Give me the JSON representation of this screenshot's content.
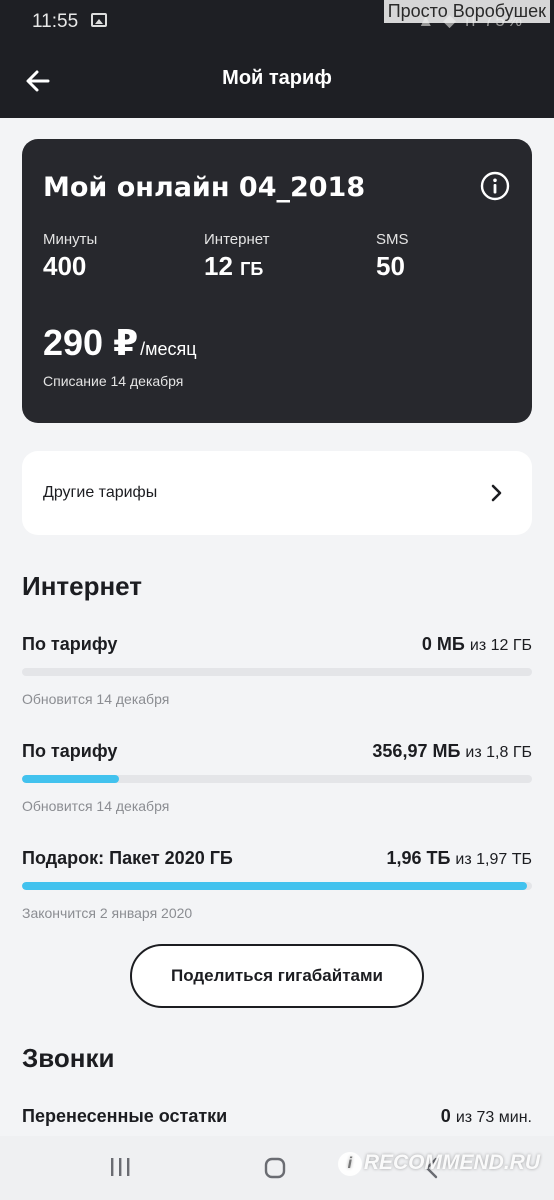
{
  "status_bar": {
    "time": "11:55",
    "right_text": "▲ ◆ ıl 75%"
  },
  "watermark_top": "Просто Воробушек",
  "header": {
    "title": "Мой тариф"
  },
  "tariff": {
    "name": "Мой онлайн 04_2018",
    "minutes": {
      "label": "Минуты",
      "value": "400"
    },
    "internet": {
      "label": "Интернет",
      "value": "12",
      "unit": "ГБ"
    },
    "sms": {
      "label": "SMS",
      "value": "50"
    },
    "price": "290 ₽",
    "period": "/месяц",
    "charge_note": "Списание 14 декабря"
  },
  "other_tariffs": {
    "label": "Другие тарифы"
  },
  "internet_section": {
    "title": "Интернет",
    "items": [
      {
        "title": "По тарифу",
        "used": "0 МБ",
        "total": "из 12 ГБ",
        "progress": 0,
        "note": "Обновится 14 декабря"
      },
      {
        "title": "По тарифу",
        "used": "356,97 МБ",
        "total": "из 1,8 ГБ",
        "progress": 0.19,
        "note": "Обновится 14 декабря"
      },
      {
        "title": "Подарок: Пакет 2020 ГБ",
        "used": "1,96 ТБ",
        "total": "из 1,97 ТБ",
        "progress": 0.99,
        "note": "Закончится 2 января 2020"
      }
    ]
  },
  "share_button": "Поделиться гигабайтами",
  "calls_section": {
    "title": "Звонки",
    "carryover": {
      "title": "Перенесенные остатки",
      "used": "0",
      "total": "из 73 мин."
    }
  },
  "watermark_bottom": {
    "badge": "i",
    "text": "RECOMMEND.RU"
  },
  "colors": {
    "accent": "#42c2ee",
    "dark_card": "#27282d",
    "header_bg": "#1e1f24"
  }
}
